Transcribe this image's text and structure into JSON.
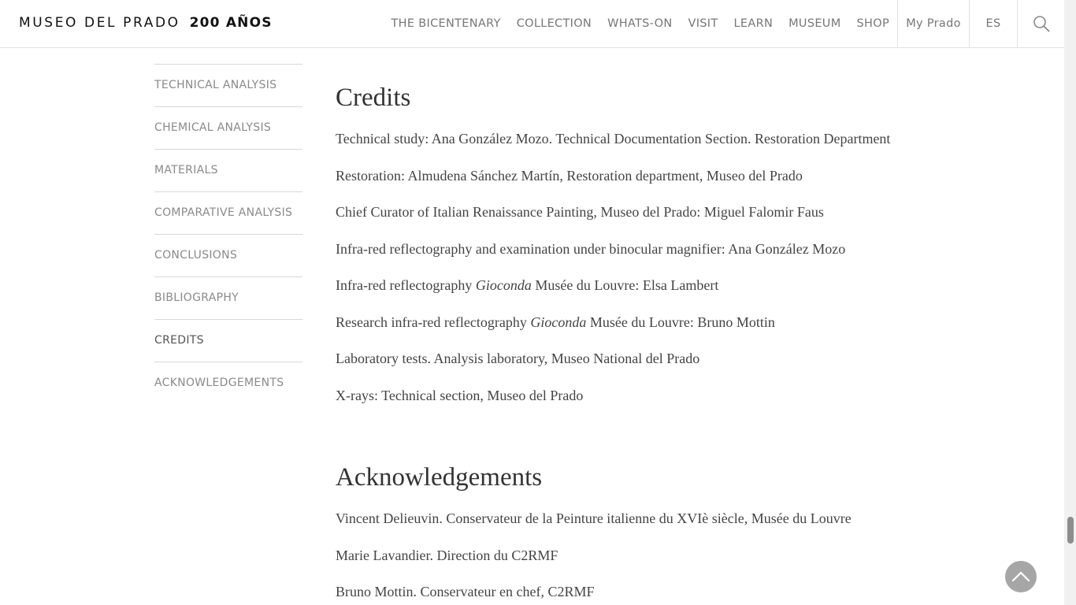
{
  "header": {
    "logo_light": "MUSEO DEL PRADO",
    "logo_bold": "200 AÑOS",
    "nav": [
      "THE BICENTENARY",
      "COLLECTION",
      "WHATS-ON",
      "VISIT",
      "LEARN",
      "MUSEUM",
      "SHOP"
    ],
    "my_prado": "My Prado",
    "language": "ES",
    "search_icon": "search-icon"
  },
  "sidebar": {
    "items": [
      {
        "label": "TECHNICAL ANALYSIS"
      },
      {
        "label": "CHEMICAL ANALYSIS"
      },
      {
        "label": "MATERIALS"
      },
      {
        "label": "COMPARATIVE ANALYSIS"
      },
      {
        "label": "CONCLUSIONS"
      },
      {
        "label": "BIBLIOGRAPHY"
      },
      {
        "label": "CREDITS",
        "active": true
      },
      {
        "label": "ACKNOWLEDGEMENTS"
      }
    ]
  },
  "credits": {
    "title": "Credits",
    "lines": [
      {
        "text": "Technical study: Ana González Mozo. Technical Documentation Section. Restoration Department"
      },
      {
        "text": "Restoration: Almudena Sánchez Martín, Restoration department, Museo del Prado"
      },
      {
        "text": "Chief Curator of Italian Renaissance Painting, Museo del Prado: Miguel Falomir Faus"
      },
      {
        "text": "Infra-red reflectography and examination under binocular magnifier: Ana González Mozo"
      },
      {
        "pre": "Infra-red reflectography ",
        "em": "Gioconda",
        "post": " Musée du Louvre: Elsa Lambert"
      },
      {
        "pre": "Research infra-red reflectography ",
        "em": "Gioconda",
        "post": " Musée du Louvre: Bruno Mottin"
      },
      {
        "text": "Laboratory tests. Analysis laboratory, Museo National del Prado"
      },
      {
        "text": "X-rays: Technical section, Museo del Prado"
      }
    ]
  },
  "acknowledgements": {
    "title": "Acknowledgements",
    "lines": [
      "Vincent Delieuvin. Conservateur de la Peinture italienne du XVIè siècle, Musée du Louvre",
      "Marie Lavandier. Direction du C2RMF",
      "Bruno Mottin. Conservateur en chef, C2RMF"
    ]
  },
  "colors": {
    "accent_text": "#333333",
    "muted_nav": "#777777",
    "to_top_button": "#a6a6a6"
  },
  "to_top_icon": "chevron-up-icon"
}
